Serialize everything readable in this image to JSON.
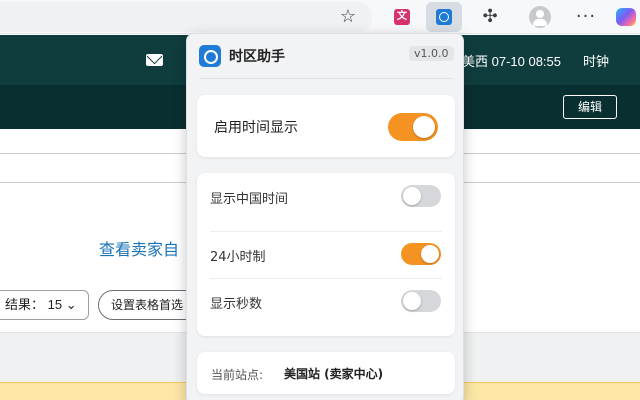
{
  "browser": {
    "star_icon": "star-icon",
    "extensions": [
      "translate-extension-icon",
      "timezone-extension-icon",
      "puzzle-icon"
    ],
    "more_label": "···"
  },
  "page": {
    "header_time": "美西 07-10 08:55",
    "clock_label": "时钟",
    "edit_button": "编辑",
    "seller_link": "查看卖家自",
    "results_label": "结果：  15",
    "pref_button": "设置表格首选"
  },
  "popup": {
    "title": "时区助手",
    "version": "v1.0.0",
    "main_toggle": {
      "label": "启用时间显示",
      "on": true
    },
    "options": [
      {
        "label": "显示中国时间",
        "on": false
      },
      {
        "label": "24小时制",
        "on": true
      },
      {
        "label": "显示秒数",
        "on": false
      }
    ],
    "site": {
      "label": "当前站点:",
      "value": "美国站 (卖家中心)"
    }
  },
  "colors": {
    "accent": "#f59322",
    "header_bg": "#0f3d3e",
    "subheader_bg": "#0a2f31",
    "link": "#1a73b8"
  }
}
